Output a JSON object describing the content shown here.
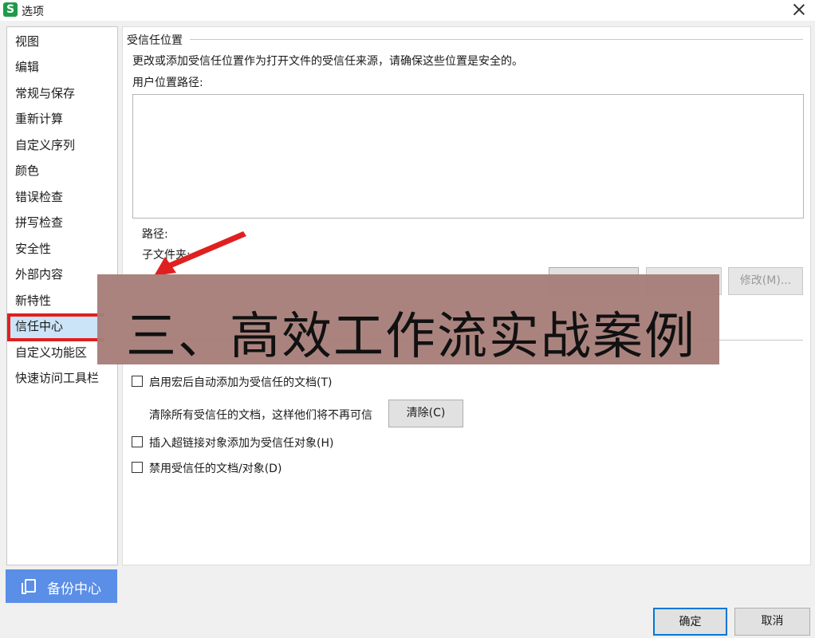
{
  "window": {
    "title": "选项",
    "app_icon_letter": "S",
    "close_icon": "close-icon"
  },
  "sidebar": {
    "items": [
      {
        "label": "视图"
      },
      {
        "label": "编辑"
      },
      {
        "label": "常规与保存"
      },
      {
        "label": "重新计算"
      },
      {
        "label": "自定义序列"
      },
      {
        "label": "颜色"
      },
      {
        "label": "错误检查"
      },
      {
        "label": "拼写检查"
      },
      {
        "label": "安全性"
      },
      {
        "label": "外部内容"
      },
      {
        "label": "新特性"
      },
      {
        "label": "信任中心",
        "selected": true
      },
      {
        "label": "自定义功能区"
      },
      {
        "label": "快速访问工具栏"
      }
    ],
    "backup_label": "备份中心"
  },
  "main": {
    "section_title": "受信任位置",
    "description": "更改或添加受信任位置作为打开文件的受信任来源，请确保这些位置是安全的。",
    "user_paths_label": "用户位置路径:",
    "path_label": "路径:",
    "subfolder_label": "子文件夹:",
    "modify_button": "修改(M)...",
    "options": {
      "auto_trust_macro": "启用宏后自动添加为受信任的文档(T)",
      "clear_text": "清除所有受信任的文档，这样他们将不再可信",
      "clear_button": "清除(C)",
      "hyperlink_trust": "插入超链接对象添加为受信任对象(H)",
      "disable_trust": "禁用受信任的文档/对象(D)"
    }
  },
  "footer": {
    "ok": "确定",
    "cancel": "取消"
  },
  "overlay": {
    "caption": "三、高效工作流实战案例"
  },
  "colors": {
    "highlight_border": "#e02020",
    "arrow": "#e02020",
    "overlay_bg": "#a77e7a",
    "backup_bg": "#5b8ee6",
    "ok_border": "#0078d7"
  }
}
